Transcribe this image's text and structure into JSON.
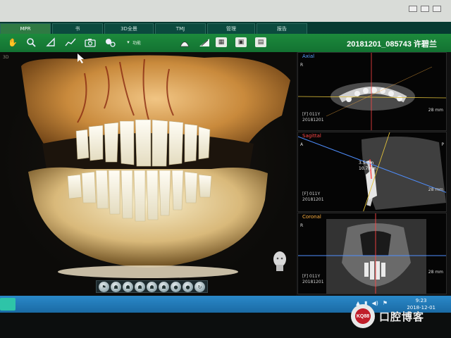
{
  "tabs": [
    {
      "label": "MPR",
      "active": true
    },
    {
      "label": "书",
      "active": false
    },
    {
      "label": "3D全景",
      "active": false
    },
    {
      "label": "TMJ",
      "active": false
    },
    {
      "label": "管理",
      "active": false
    },
    {
      "label": "报告",
      "active": false
    }
  ],
  "toolbar": {
    "tools": [
      "hand-icon",
      "zoom-icon",
      "ruler-angle-icon",
      "polyline-icon",
      "camera-icon",
      "settings-icon"
    ],
    "more_label": "功能",
    "right_tools": [
      "airway-icon",
      "measure-icon",
      "layout-icon",
      "image-icon",
      "export-icon"
    ]
  },
  "patient": {
    "id": "20181201_085743 许碧兰"
  },
  "view3d": {
    "label": "3D",
    "view_tools": [
      "⚑",
      "☗",
      "☗",
      "☗",
      "☗",
      "☗",
      "●",
      "●",
      "↻"
    ]
  },
  "axial": {
    "title": "Axial",
    "side": "R",
    "mm": "28 mm"
  },
  "sagittal": {
    "title": "Sagittal",
    "left": "A",
    "right": "P",
    "mm": "28 mm",
    "meta_line1": "[F] 011Y",
    "meta_line2": "20181201",
    "measure1": "3.5mm",
    "measure2": "10.7mm"
  },
  "coronal": {
    "title": "Coronal",
    "side": "R",
    "mm": "28 mm",
    "meta_line1": "[F] 011Y",
    "meta_line2": "20181201"
  },
  "axial_meta": {
    "line1": "[F] 011Y",
    "line2": "20181201"
  },
  "taskbar": {
    "time": "9:23",
    "date": "2018-12-01"
  },
  "watermark": {
    "badge": "KQ88",
    "text": "口腔博客"
  }
}
